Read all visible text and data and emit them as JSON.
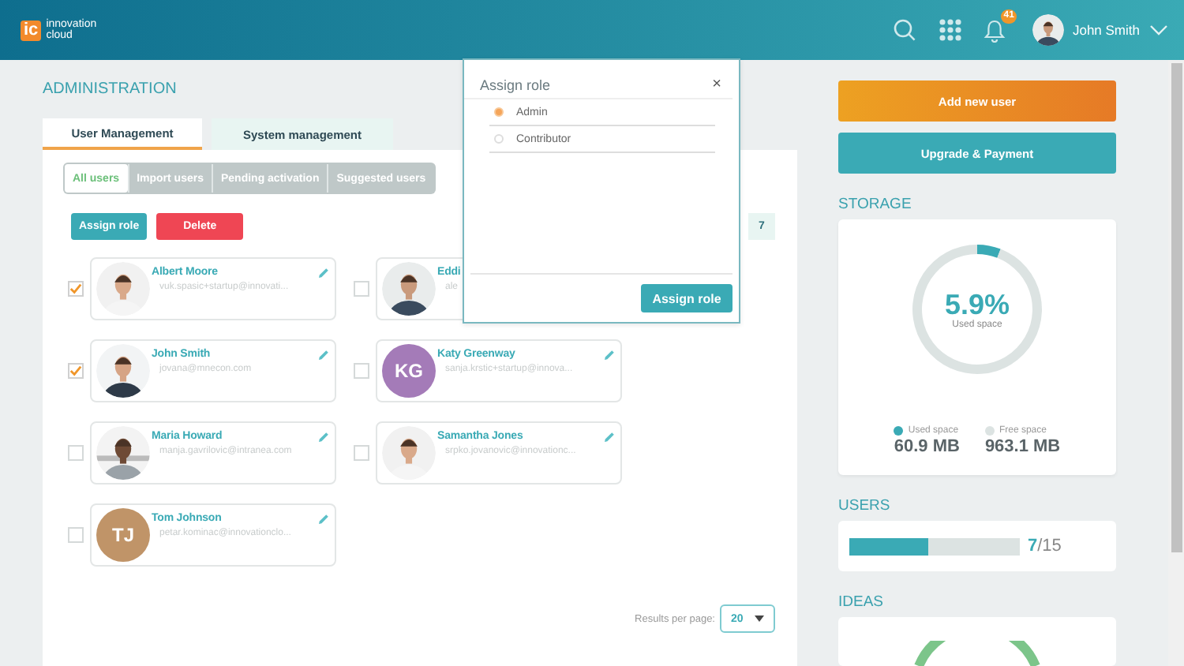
{
  "header": {
    "logo": {
      "mark": "ic",
      "lines": [
        "innovation",
        "cloud"
      ]
    },
    "notifications": "41",
    "user": "John Smith"
  },
  "page_title": "ADMINISTRATION",
  "tabs": [
    {
      "label": "User Management",
      "selected": true
    },
    {
      "label": "System management",
      "selected": false
    }
  ],
  "filters": [
    {
      "label": "All users",
      "selected": true
    },
    {
      "label": "Import users",
      "selected": false
    },
    {
      "label": "Pending activation",
      "selected": false
    },
    {
      "label": "Suggested users",
      "selected": false
    }
  ],
  "actions": [
    {
      "label": "Assign role",
      "kind": "primary"
    },
    {
      "label": "Delete",
      "kind": "danger"
    }
  ],
  "count": "7",
  "users": [
    {
      "name": "Albert Moore",
      "email": "vuk.spasic+startup@innovati...",
      "checked": true
    },
    {
      "name": "Eddi",
      "email": "ale",
      "checked": false
    },
    {
      "name": "John Smith",
      "email": "jovana@mnecon.com",
      "checked": true
    },
    {
      "name": "Katy Greenway",
      "email": "sanja.krstic+startup@innova...",
      "checked": false,
      "avatar": {
        "kind": "initials",
        "initials": "KG",
        "color": "#a47bb8"
      }
    },
    {
      "name": "Maria Howard",
      "email": "manja.gavrilovic@intranea.com",
      "checked": false
    },
    {
      "name": "Samantha Jones",
      "email": "srpko.jovanovic@innovationc...",
      "checked": false
    },
    {
      "name": "Tom Johnson",
      "email": "petar.kominac@innovationclo...",
      "checked": false,
      "avatar": {
        "kind": "initials",
        "initials": "TJ",
        "color": "#c09468"
      }
    }
  ],
  "pagination": {
    "label": "Results per page:",
    "value": "20"
  },
  "modal": {
    "title": "Assign role",
    "close": "×",
    "options": [
      {
        "label": "Admin",
        "selected": true
      },
      {
        "label": "Contributor",
        "selected": false
      }
    ],
    "button": "Assign role"
  },
  "side_buttons": [
    {
      "label": "Add new user",
      "kind": "accent"
    },
    {
      "label": "Upgrade & Payment",
      "kind": "primary"
    }
  ],
  "storage": {
    "title": "STORAGE",
    "percent": "5.9%",
    "caption": "Used space",
    "chart_data": {
      "type": "donut",
      "categories": [
        "Used space",
        "Free space"
      ],
      "values": [
        5.9,
        94.1
      ]
    },
    "legend": [
      {
        "value": "60.9 MB",
        "color": "#3aaab5"
      },
      {
        "value": "963.1 MB",
        "color": "#dce3e2"
      }
    ]
  },
  "users_quota": {
    "title": "USERS",
    "level": 0.467,
    "reading": "**7**/15"
  },
  "ideas": {
    "title": "IDEAS"
  }
}
